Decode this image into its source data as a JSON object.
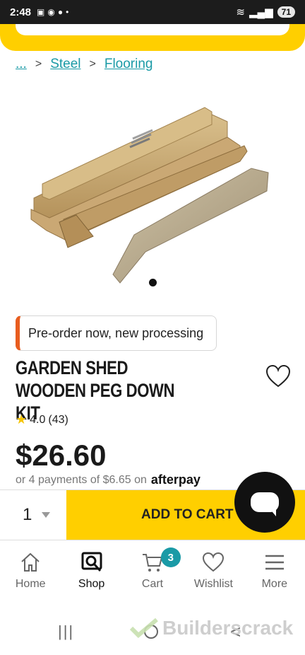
{
  "status_bar": {
    "time": "2:48",
    "battery": "71"
  },
  "breadcrumb": {
    "ellipsis": "...",
    "items": [
      "Steel",
      "Flooring"
    ],
    "separator": ">"
  },
  "product": {
    "banner": "Pre-order now, new processing",
    "title": "GARDEN SHED WOODEN PEG DOWN KIT",
    "rating": "4.0",
    "review_count": "(43)",
    "price": "$26.60",
    "afterpay_text": "or 4 payments of $6.65 on",
    "afterpay_brand": "afterpay"
  },
  "purchase": {
    "quantity": "1",
    "add_to_cart": "ADD TO CART"
  },
  "nav": {
    "home": "Home",
    "shop": "Shop",
    "cart": "Cart",
    "cart_count": "3",
    "wishlist": "Wishlist",
    "more": "More"
  },
  "watermark": "Builderscrack",
  "colors": {
    "brand_yellow": "#ffcf00",
    "link_teal": "#1a9aa6",
    "banner_accent": "#e85d1f"
  }
}
